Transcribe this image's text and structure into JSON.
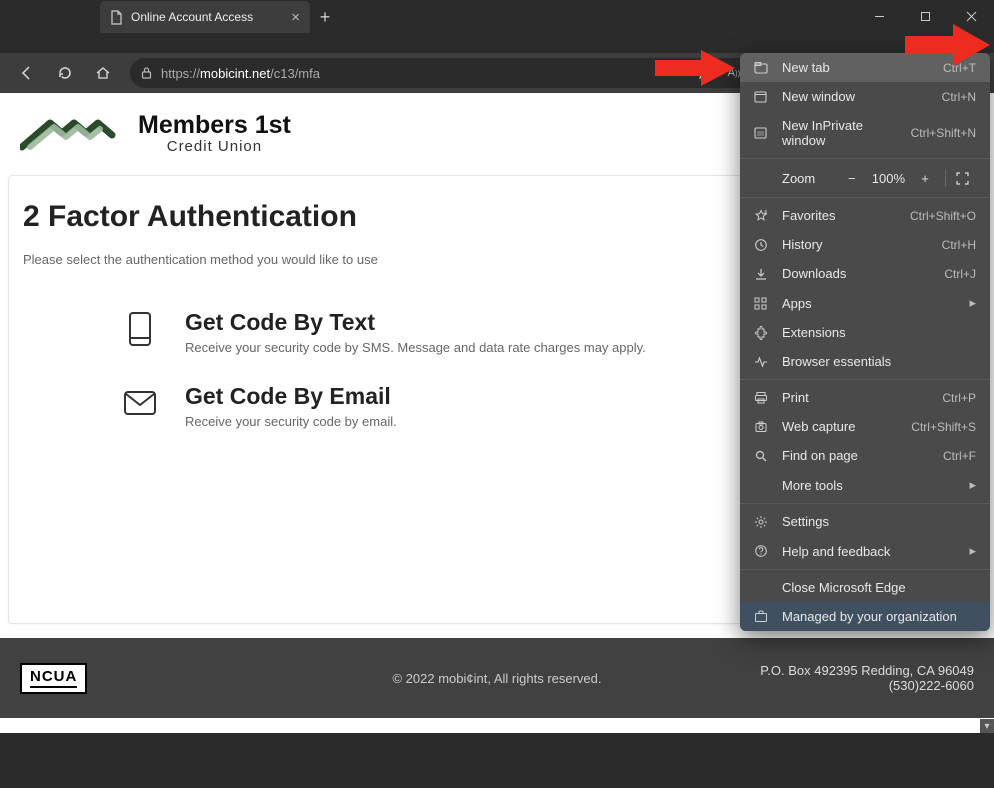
{
  "browser": {
    "tab_title": "Online Account Access",
    "url_prefix": "https://",
    "url_host": "mobicint.net",
    "url_path": "/c13/mfa"
  },
  "logo": {
    "line1": "Members 1st",
    "line2": "Credit Union"
  },
  "page": {
    "heading": "2 Factor Authentication",
    "subtitle": "Please select the authentication method you would like to use",
    "methods": [
      {
        "title": "Get Code By Text",
        "desc": "Receive your security code by SMS. Message and data rate charges may apply."
      },
      {
        "title": "Get Code By Email",
        "desc": "Receive your security code by email."
      }
    ]
  },
  "footer": {
    "ncua": "NCUA",
    "copyright": "© 2022 mobi¢int, All rights reserved.",
    "address_line1": "P.O. Box 492395 Redding, CA 96049",
    "address_line2": "(530)222-6060"
  },
  "menu": {
    "new_tab": {
      "label": "New tab",
      "shortcut": "Ctrl+T"
    },
    "new_window": {
      "label": "New window",
      "shortcut": "Ctrl+N"
    },
    "inprivate": {
      "label": "New InPrivate window",
      "shortcut": "Ctrl+Shift+N"
    },
    "zoom_label": "Zoom",
    "zoom_value": "100%",
    "favorites": {
      "label": "Favorites",
      "shortcut": "Ctrl+Shift+O"
    },
    "history": {
      "label": "History",
      "shortcut": "Ctrl+H"
    },
    "downloads": {
      "label": "Downloads",
      "shortcut": "Ctrl+J"
    },
    "apps": {
      "label": "Apps"
    },
    "extensions": {
      "label": "Extensions"
    },
    "essentials": {
      "label": "Browser essentials"
    },
    "print": {
      "label": "Print",
      "shortcut": "Ctrl+P"
    },
    "web_capture": {
      "label": "Web capture",
      "shortcut": "Ctrl+Shift+S"
    },
    "find": {
      "label": "Find on page",
      "shortcut": "Ctrl+F"
    },
    "more_tools": {
      "label": "More tools"
    },
    "settings": {
      "label": "Settings"
    },
    "help": {
      "label": "Help and feedback"
    },
    "close": {
      "label": "Close Microsoft Edge"
    },
    "managed": {
      "label": "Managed by your organization"
    }
  }
}
